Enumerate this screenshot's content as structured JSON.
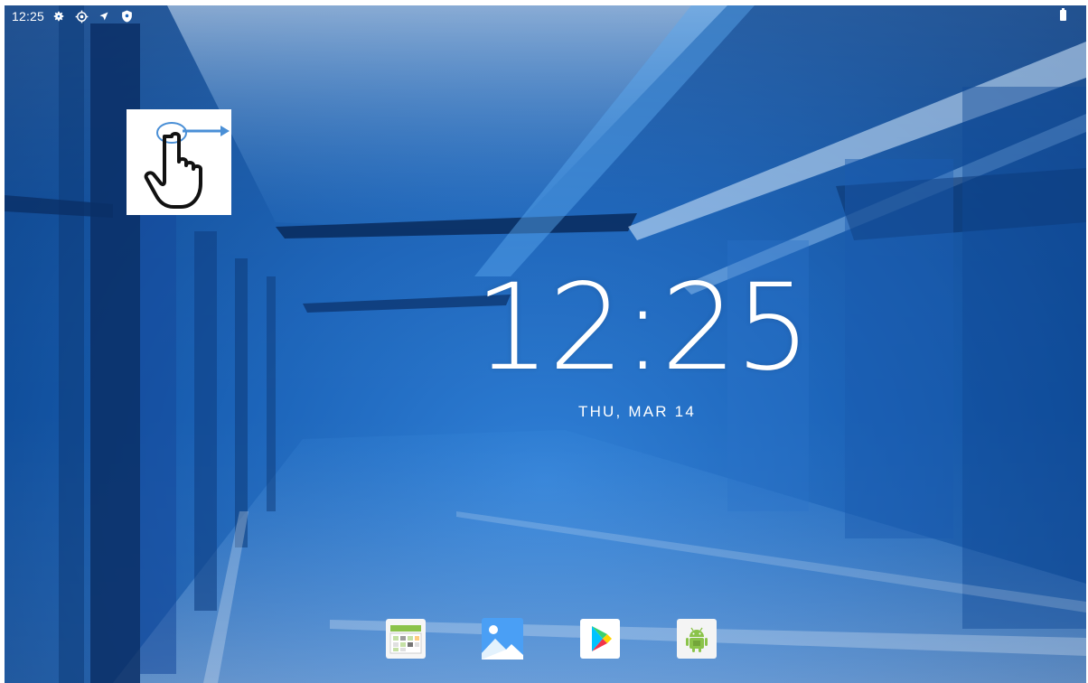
{
  "status_bar": {
    "time": "12:25",
    "icons": [
      "settings-gear-icon",
      "crosshair-location-icon",
      "navigation-arrow-icon",
      "shield-icon"
    ],
    "battery_icon": "battery-icon"
  },
  "overlay": {
    "gesture_icon": "swipe-right-hand-icon"
  },
  "lock_clock": {
    "time": "12:25",
    "date": "THU, MAR 14"
  },
  "dock": {
    "apps": [
      {
        "icon": "calendar-app-icon"
      },
      {
        "icon": "gallery-app-icon"
      },
      {
        "icon": "play-store-icon"
      },
      {
        "icon": "android-app-icon"
      }
    ]
  },
  "colors": {
    "wallpaper_primary": "#1c64b9",
    "wallpaper_dark": "#0a3e83",
    "text": "#ffffff",
    "gesture_arrow": "#4a8fd6"
  }
}
